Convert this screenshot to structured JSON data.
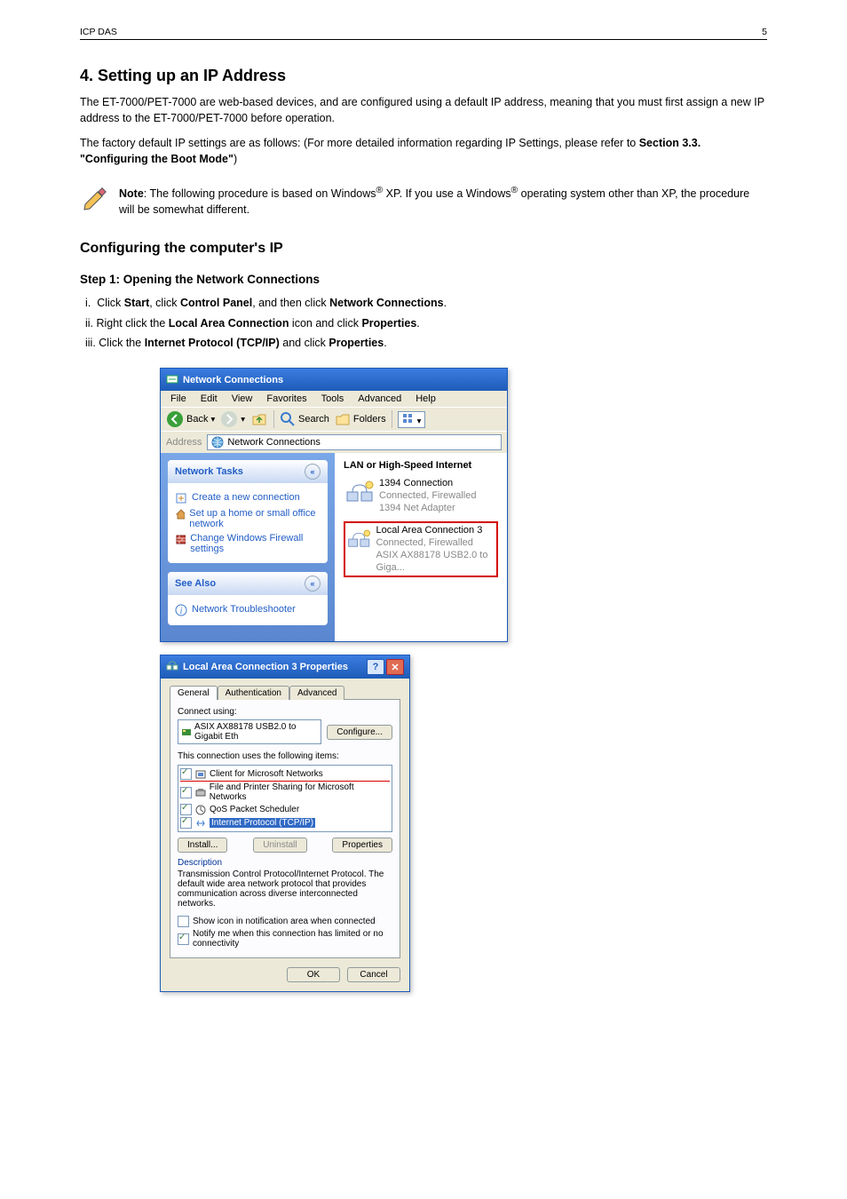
{
  "header": {
    "left": "ICP DAS",
    "right": "5"
  },
  "title": "4. Setting up an IP Address",
  "para1": "The ET-7000/PET-7000 are web-based devices, and are configured using a default IP address, meaning that you must first assign a new IP address to the ET-7000/PET-7000 before operation.",
  "para2_prefix": "The factory default IP settings are as follows: (For more detailed information regarding IP Settings, please refer to ",
  "para2_link": "Section 3.3. \"Configuring the Boot Mode\"",
  "para2_suffix": ")",
  "h2": "Configuring the computer's IP",
  "h3": "Step 1: Opening the Network Connections",
  "steps": [
    {
      "pre": "i. Click ",
      "b1": "Start",
      ", click ": "",
      "b2": "Control Panel",
      ", and then click ": "",
      "b3": "Network Connections",
      "tail": "."
    },
    {
      "text": "ii. Right click the Local Area Connection icon and click Properties.",
      "bolds": [
        "Local Area Connection",
        "Properties"
      ]
    },
    {
      "text": "iii. Click the Internet Protocol (TCP/IP) and click Properties.",
      "bolds": [
        "Internet Protocol (TCP/IP)",
        "Properties"
      ]
    }
  ],
  "note": {
    "label": "Note",
    "body": "The following procedure is based on Windows® XP. If you use a Windows® operating system other than XP, the procedure will be somewhat different."
  },
  "win1": {
    "title": "Network Connections",
    "menu": [
      "File",
      "Edit",
      "View",
      "Favorites",
      "Tools",
      "Advanced",
      "Help"
    ],
    "toolbar": {
      "back": "Back",
      "search": "Search",
      "folders": "Folders"
    },
    "address_label": "Address",
    "address_value": "Network Connections",
    "sidebar": {
      "tasks_title": "Network Tasks",
      "tasks": [
        "Create a new connection",
        "Set up a home or small office network",
        "Change Windows Firewall settings"
      ],
      "seealso_title": "See Also",
      "seealso": [
        "Network Troubleshooter"
      ]
    },
    "group": "LAN or High-Speed Internet",
    "conn1": {
      "name": "1394 Connection",
      "status": "Connected, Firewalled",
      "dev": "1394 Net Adapter"
    },
    "conn2": {
      "name": "Local Area Connection 3",
      "status": "Connected, Firewalled",
      "dev": "ASIX AX88178 USB2.0 to Giga..."
    }
  },
  "win2": {
    "title": "Local Area Connection 3 Properties",
    "tabs": [
      "General",
      "Authentication",
      "Advanced"
    ],
    "connect_using_label": "Connect using:",
    "adapter": "ASIX AX88178 USB2.0 to Gigabit Eth",
    "configure": "Configure...",
    "uses_label": "This connection uses the following items:",
    "items": [
      {
        "checked": true,
        "label": "Client for Microsoft Networks",
        "hl": false,
        "red": true
      },
      {
        "checked": true,
        "label": "File and Printer Sharing for Microsoft Networks",
        "hl": false,
        "red": false
      },
      {
        "checked": true,
        "label": "QoS Packet Scheduler",
        "hl": false,
        "red": false
      },
      {
        "checked": true,
        "label": "Internet Protocol (TCP/IP)",
        "hl": true,
        "red": false
      }
    ],
    "install": "Install...",
    "uninstall": "Uninstall",
    "properties": "Properties",
    "desc_label": "Description",
    "desc_text": "Transmission Control Protocol/Internet Protocol. The default wide area network protocol that provides communication across diverse interconnected networks.",
    "cb1": "Show icon in notification area when connected",
    "cb2": "Notify me when this connection has limited or no connectivity",
    "ok": "OK",
    "cancel": "Cancel"
  }
}
